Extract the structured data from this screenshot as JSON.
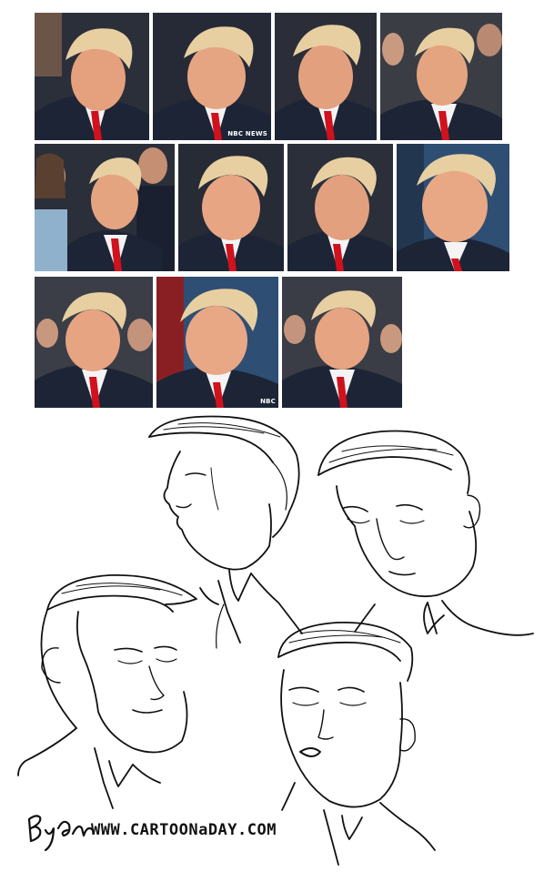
{
  "photo_grid": {
    "network_logo_text": "NBC NEWS",
    "network_logo_short": "NBC",
    "colors": {
      "suit": "#1d2436",
      "tie": "#d0111e",
      "shirt": "#f4f4f4",
      "skin": "#e5a07e",
      "hair": "#e7cfa2",
      "background_dark": "#2a2f3a",
      "background_blue": "#2f4e73",
      "background_red": "#8a1f23"
    }
  },
  "sketches": {
    "website": "WWW.CARTOONaDAY.COM",
    "line_color": "#111111"
  }
}
